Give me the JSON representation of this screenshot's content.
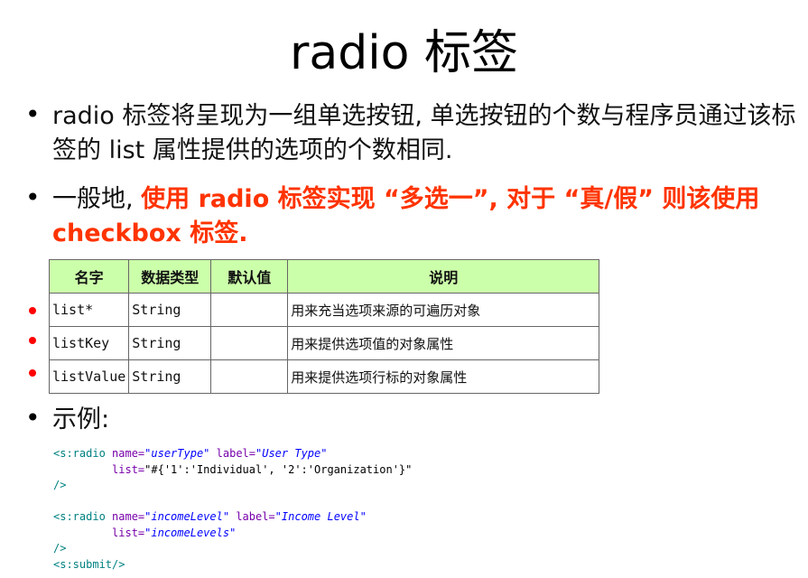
{
  "title": "radio 标签",
  "bullets": {
    "b1": "radio 标签将呈现为一组单选按钮, 单选按钮的个数与程序员通过该标签的 list 属性提供的选项的个数相同.",
    "b2_prefix": "一般地, ",
    "b2_emphasis": "使用 radio 标签实现 “多选一”, 对于 “真/假” 则该使用 checkbox 标签.",
    "b3": "示例:"
  },
  "table": {
    "headers": [
      "名字",
      "数据类型",
      "默认值",
      "说明"
    ],
    "rows": [
      {
        "name": "list*",
        "type": "String",
        "default": "",
        "desc": "用来充当选项来源的可遍历对象"
      },
      {
        "name": "listKey",
        "type": "String",
        "default": "",
        "desc": "用来提供选项值的对象属性"
      },
      {
        "name": "listValue",
        "type": "String",
        "default": "",
        "desc": "用来提供选项行标的对象属性"
      }
    ]
  },
  "code": {
    "l1_tag": "<s:radio",
    "l1_attr1": "name=",
    "l1_val1": "\"userType\"",
    "l1_attr2": "label=",
    "l1_val2": "\"User Type\"",
    "l2_attr": "list=",
    "l2_val": "\"#{'1':'Individual', '2':'Organization'}\"",
    "l3": "/>",
    "l5_tag": "<s:radio",
    "l5_attr1": "name=",
    "l5_val1": "\"incomeLevel\"",
    "l5_attr2": "label=",
    "l5_val2": "\"Income Level\"",
    "l6_attr": "list=",
    "l6_val": "\"incomeLevels\"",
    "l7": "/>",
    "l8": "<s:submit/>"
  },
  "colors": {
    "emphasis": "#ff3300",
    "table_header": "#ccffaa",
    "bullet_red": "#ff0000"
  }
}
